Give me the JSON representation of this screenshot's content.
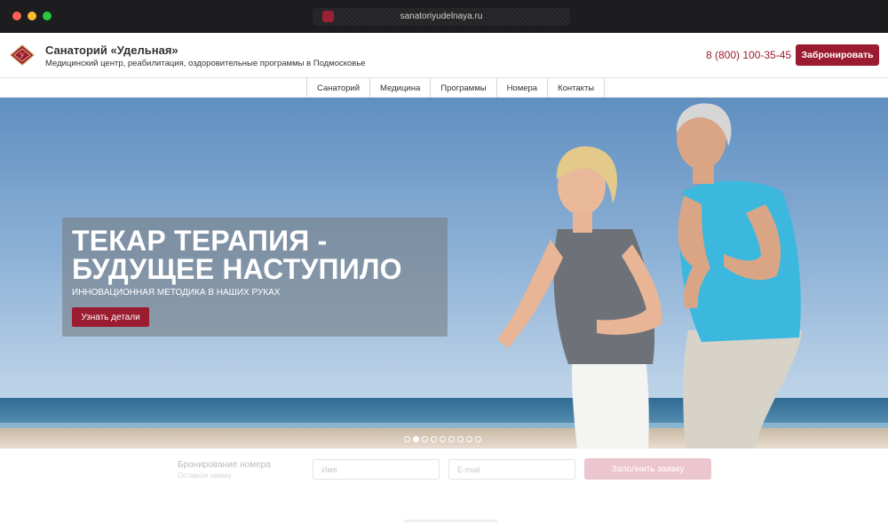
{
  "browser": {
    "url": "sanatoriyudelnaya.ru",
    "traffic_colors": [
      "#ff5f57",
      "#febc2e",
      "#28c840"
    ]
  },
  "header": {
    "title": "Санаторий «Удельная»",
    "subtitle": "Медицинский центр, реабилитация, оздоровительные программы в Подмосковье",
    "phone": "8 (800) 100-35-45",
    "book_label": "Забронировать",
    "accent_color": "#9b1b30"
  },
  "nav": {
    "items": [
      {
        "label": "Санаторий"
      },
      {
        "label": "Медицина"
      },
      {
        "label": "Программы"
      },
      {
        "label": "Номера"
      },
      {
        "label": "Контакты"
      }
    ]
  },
  "hero": {
    "title": "Текар терапия - будущее наступило",
    "subtitle": "Инновационная методика в наших руках",
    "button_label": "Узнать детали",
    "slides_count": 9,
    "active_slide": 2
  },
  "booking": {
    "title": "Бронирование номера",
    "subtitle": "Оставьте заявку",
    "name_placeholder": "Имя",
    "email_placeholder": "E-mail",
    "submit_label": "Заполнить заявку"
  }
}
